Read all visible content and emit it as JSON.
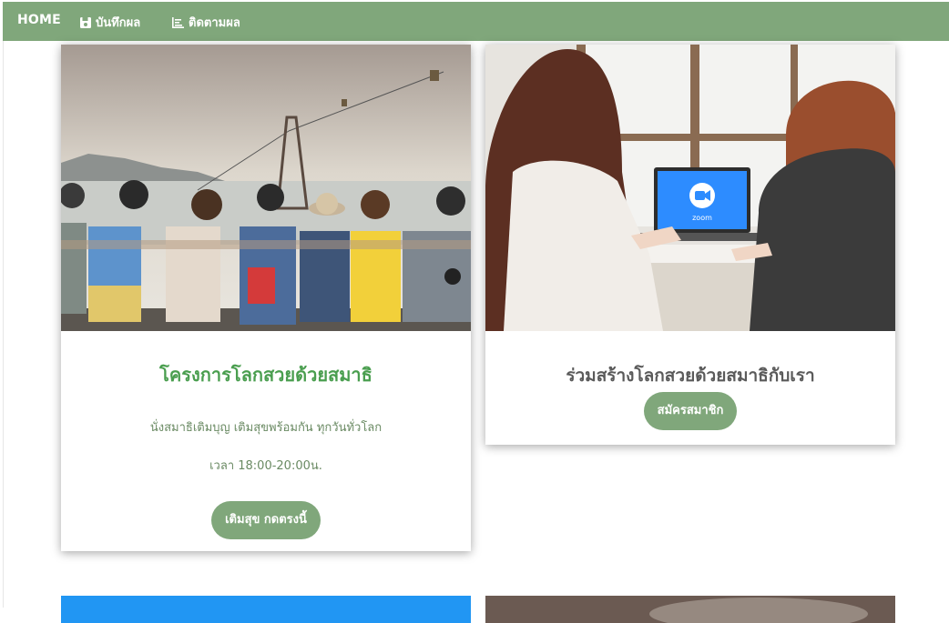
{
  "nav": {
    "home": "HOME",
    "save": "บันทึกผล",
    "track": "ติดตามผล"
  },
  "cards": [
    {
      "title": "โครงการโลกสวยด้วยสมาธิ",
      "description": "นั่งสมาธิเติมบุญ เติมสุขพร้อมกัน ทุกวันทั่วโลก",
      "time": "เวลา 18:00-20:00น.",
      "button": "เติมสุข กดตรงนี้"
    },
    {
      "title": "ร่วมสร้างโลกสวยด้วยสมาธิกับเรา",
      "button": "สมัครสมาชิก",
      "laptop_label": "zoom"
    }
  ],
  "colors": {
    "nav_bg": "#80a77b",
    "title_green": "#4a9e4f",
    "card3_top": "#2196f3",
    "zoom_blue": "#2d8cff"
  }
}
